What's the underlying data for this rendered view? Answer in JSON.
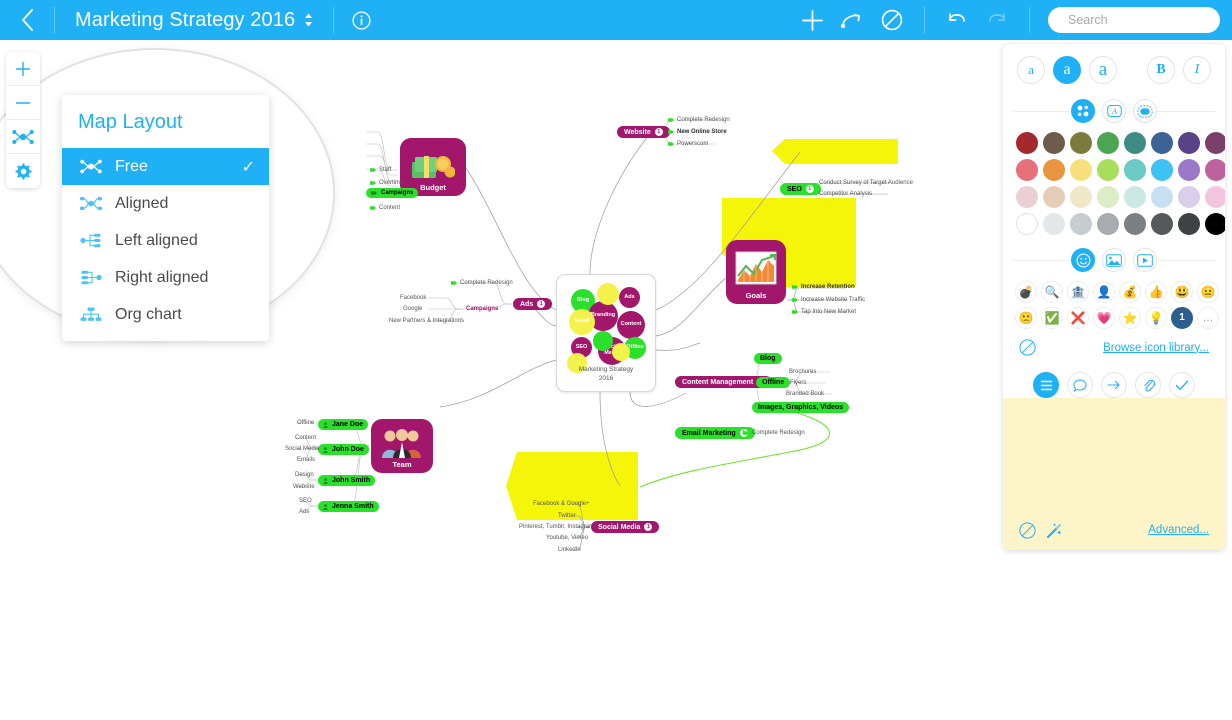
{
  "topbar": {
    "back_icon": "chevron-left-icon",
    "title": "Marketing Strategy 2016",
    "stepper_icon": "stepper-up-down-icon",
    "info_icon": "info-circle-icon",
    "add_icon": "plus-icon",
    "relation_icon": "relationship-arrow-icon",
    "boundary_icon": "no-entry-icon",
    "undo_icon": "undo-icon",
    "redo_icon": "redo-icon",
    "search_icon": "search-icon",
    "search_dropdown_icon": "caret-down-icon",
    "search_placeholder": "Search",
    "search_value": "",
    "accent": "#1fb0f5"
  },
  "left_toolbar": {
    "items": [
      {
        "name": "zoom-in-button",
        "label": "+"
      },
      {
        "name": "zoom-out-button",
        "label": "−"
      },
      {
        "name": "map-layout-button",
        "label": "layout-icon"
      },
      {
        "name": "settings-button",
        "label": "gear-icon"
      }
    ]
  },
  "layout_menu": {
    "title": "Map Layout",
    "checkmark": "✓",
    "items": [
      {
        "label": "Free",
        "icon": "layout-free-icon",
        "selected": true
      },
      {
        "label": "Aligned",
        "icon": "layout-aligned-icon",
        "selected": false
      },
      {
        "label": "Left aligned",
        "icon": "layout-left-aligned-icon",
        "selected": false
      },
      {
        "label": "Right aligned",
        "icon": "layout-right-aligned-icon",
        "selected": false
      },
      {
        "label": "Org chart",
        "icon": "layout-org-chart-icon",
        "selected": false
      }
    ]
  },
  "right_panel": {
    "font_sizes": [
      {
        "label": "a",
        "size": "small",
        "active": false
      },
      {
        "label": "a",
        "size": "medium",
        "active": true
      },
      {
        "label": "a",
        "size": "large",
        "active": false
      }
    ],
    "bold_label": "B",
    "italic_label": "I",
    "style_tabs": [
      {
        "name": "fill-color-tab",
        "icon": "color-dots-icon",
        "active": true
      },
      {
        "name": "text-color-tab",
        "icon": "letter-a-icon",
        "active": false
      },
      {
        "name": "border-color-tab",
        "icon": "shape-outline-icon",
        "active": false
      }
    ],
    "swatches": [
      [
        "#a5282c",
        "#6d5b4b",
        "#7b7c3c",
        "#4ba551",
        "#3e8b84",
        "#3c6396",
        "#594286",
        "#79406a"
      ],
      [
        "#e8707a",
        "#e89540",
        "#f7e07c",
        "#a8de5c",
        "#6ccac4",
        "#3ec1f3",
        "#9a79c6",
        "#bd629b"
      ],
      [
        "#eccfd2",
        "#e6cdb8",
        "#eee8c8",
        "#dcecc7",
        "#cbe8e4",
        "#c6e0f2",
        "#d9cfec",
        "#f0c5dd"
      ],
      [
        "#ffffff",
        "#e3e7ea",
        "#c7cccf",
        "#a7acb0",
        "#7b8084",
        "#56595c",
        "#3f4245",
        "#000000"
      ]
    ],
    "content_tabs": [
      {
        "name": "icons-tab",
        "icon": "smiley-icon",
        "active": true
      },
      {
        "name": "images-tab",
        "icon": "image-icon",
        "active": false
      },
      {
        "name": "video-tab",
        "icon": "video-play-icon",
        "active": false
      }
    ],
    "icons": [
      {
        "name": "bomb-icon",
        "glyph": "💣"
      },
      {
        "name": "magnifier-icon",
        "glyph": "🔍"
      },
      {
        "name": "bank-icon",
        "glyph": "🏦"
      },
      {
        "name": "person-icon",
        "glyph": "👤"
      },
      {
        "name": "money-bag-icon",
        "glyph": "💰"
      },
      {
        "name": "thumbs-up-icon",
        "glyph": "👍"
      },
      {
        "name": "smiley-happy-icon",
        "glyph": "😃"
      },
      {
        "name": "smiley-neutral-icon",
        "glyph": "😐"
      },
      {
        "name": "smiley-sad-icon",
        "glyph": "🙁"
      },
      {
        "name": "check-circle-icon",
        "glyph": "✅"
      },
      {
        "name": "cross-circle-icon",
        "glyph": "❌"
      },
      {
        "name": "heart-icon",
        "glyph": "💗"
      },
      {
        "name": "star-icon",
        "glyph": "⭐"
      },
      {
        "name": "lightbulb-icon",
        "glyph": "💡"
      },
      {
        "name": "number-one-icon",
        "glyph": "❶"
      },
      {
        "name": "more-dots-icon",
        "glyph": "…"
      }
    ],
    "clear_icon": "no-symbol-icon",
    "browse_link": "Browse icon library...",
    "note_tabs": [
      {
        "name": "notes-tab",
        "icon": "lines-icon",
        "active": true
      },
      {
        "name": "comment-tab",
        "icon": "speech-bubble-icon",
        "active": false
      },
      {
        "name": "link-tab",
        "icon": "arrow-right-icon",
        "active": false
      },
      {
        "name": "attachment-tab",
        "icon": "paperclip-icon",
        "active": false
      },
      {
        "name": "task-tab",
        "icon": "checkmark-icon",
        "active": false
      }
    ],
    "notes_value": "",
    "notes_clear_icon": "no-symbol-icon",
    "notes_magic_icon": "magic-wand-icon",
    "advanced_link": "Advanced...",
    "notes_bg": "#fdf4c8"
  },
  "mindmap": {
    "central": {
      "title": "Marketing Strategy",
      "subtitle": "2016",
      "bubbles": [
        {
          "label": "Blog",
          "color": "#2ae02a"
        },
        {
          "label": "Ads",
          "color": "#a2176b"
        },
        {
          "label": "Branding",
          "color": "#a2176b"
        },
        {
          "label": "Email",
          "color": "#f2f24b"
        },
        {
          "label": "Content",
          "color": "#a2176b"
        },
        {
          "label": "SEO",
          "color": "#a2176b"
        },
        {
          "label": "Offline",
          "color": "#2ae02a"
        },
        {
          "label": "Social Media",
          "color": "#a2176b"
        }
      ]
    },
    "branches": [
      {
        "name": "budget",
        "label": "Budget",
        "style": "image-box-magenta",
        "image_icon": "money-stack-icon",
        "children": [
          "Staff",
          "Overtime",
          "Campaigns",
          "Content"
        ],
        "highlighted_child": "Campaigns"
      },
      {
        "name": "website",
        "label": "Website",
        "style": "pill-magenta",
        "badge": "1",
        "children": [
          "Complete Redesign",
          "New Online Store",
          "Powerscom"
        ],
        "highlighted_child": "New Online Store"
      },
      {
        "name": "seo",
        "label": "SEO",
        "style": "pill-green-on-yellow",
        "badge": "1",
        "children": [
          "Conduct Survey of Target Audience",
          "Competitor Analysis"
        ]
      },
      {
        "name": "goals",
        "label": "Goals",
        "style": "image-box-magenta-on-yellow",
        "image_icon": "chart-icon",
        "children": [
          "Increase Retention",
          "Increase Website Traffic",
          "Tap Into New Market"
        ],
        "highlighted_child": "Increase Retention"
      },
      {
        "name": "ads",
        "label": "Ads",
        "style": "pill-magenta",
        "badge": "1",
        "children": [
          "Campaigns",
          "Complete Redesign"
        ],
        "grandchildren": [
          "Facebook",
          "Google",
          "New Partners & Integrations"
        ]
      },
      {
        "name": "content-management",
        "label": "Content Management",
        "style": "pill-magenta",
        "badge": "1",
        "children": [
          "Blog",
          "Offline",
          "Images, Graphics, Videos"
        ],
        "grandchildren": [
          "Brochures",
          "Flyers",
          "Branded Book"
        ]
      },
      {
        "name": "email-marketing",
        "label": "Email Marketing",
        "style": "pill-green",
        "badge": "1",
        "children": [
          "Complete Redesign"
        ]
      },
      {
        "name": "social-media",
        "label": "Social Media",
        "style": "pill-magenta-on-yellow",
        "badge": "1",
        "children": [
          "Facebook & Google+",
          "Twitter",
          "Pinterest, Tumblr, Instagram",
          "Youtube, Vimeo",
          "LinkedIn"
        ]
      },
      {
        "name": "team",
        "label": "Team",
        "style": "image-box-magenta",
        "image_icon": "people-icon",
        "children": [
          "Jane Doe",
          "John Doe",
          "John Smith",
          "Jenna Smith"
        ],
        "grandchildren": [
          "Offline",
          "Content",
          "Social Media",
          "Emails",
          "Design",
          "Website",
          "SEO",
          "Ads"
        ]
      }
    ]
  }
}
